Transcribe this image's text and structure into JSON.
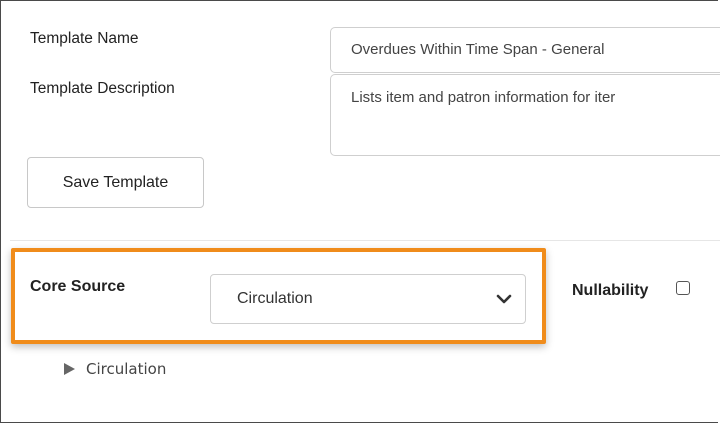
{
  "template": {
    "name_label": "Template Name",
    "name_value": "Overdues Within Time Span  -  General",
    "description_label": "Template Description",
    "description_value": "Lists item and patron information for iter",
    "save_label": "Save Template"
  },
  "source": {
    "core_source_label": "Core Source",
    "core_source_selected": "Circulation",
    "nullability_label": "Nullability",
    "nullability_checked": false,
    "highlight_color": "#f08c1b"
  },
  "tree": {
    "items": [
      {
        "label": "Circulation",
        "expanded": false
      }
    ]
  },
  "icons": {
    "select_caret": "chevron-down-icon",
    "tree_caret": "triangle-right-icon"
  }
}
